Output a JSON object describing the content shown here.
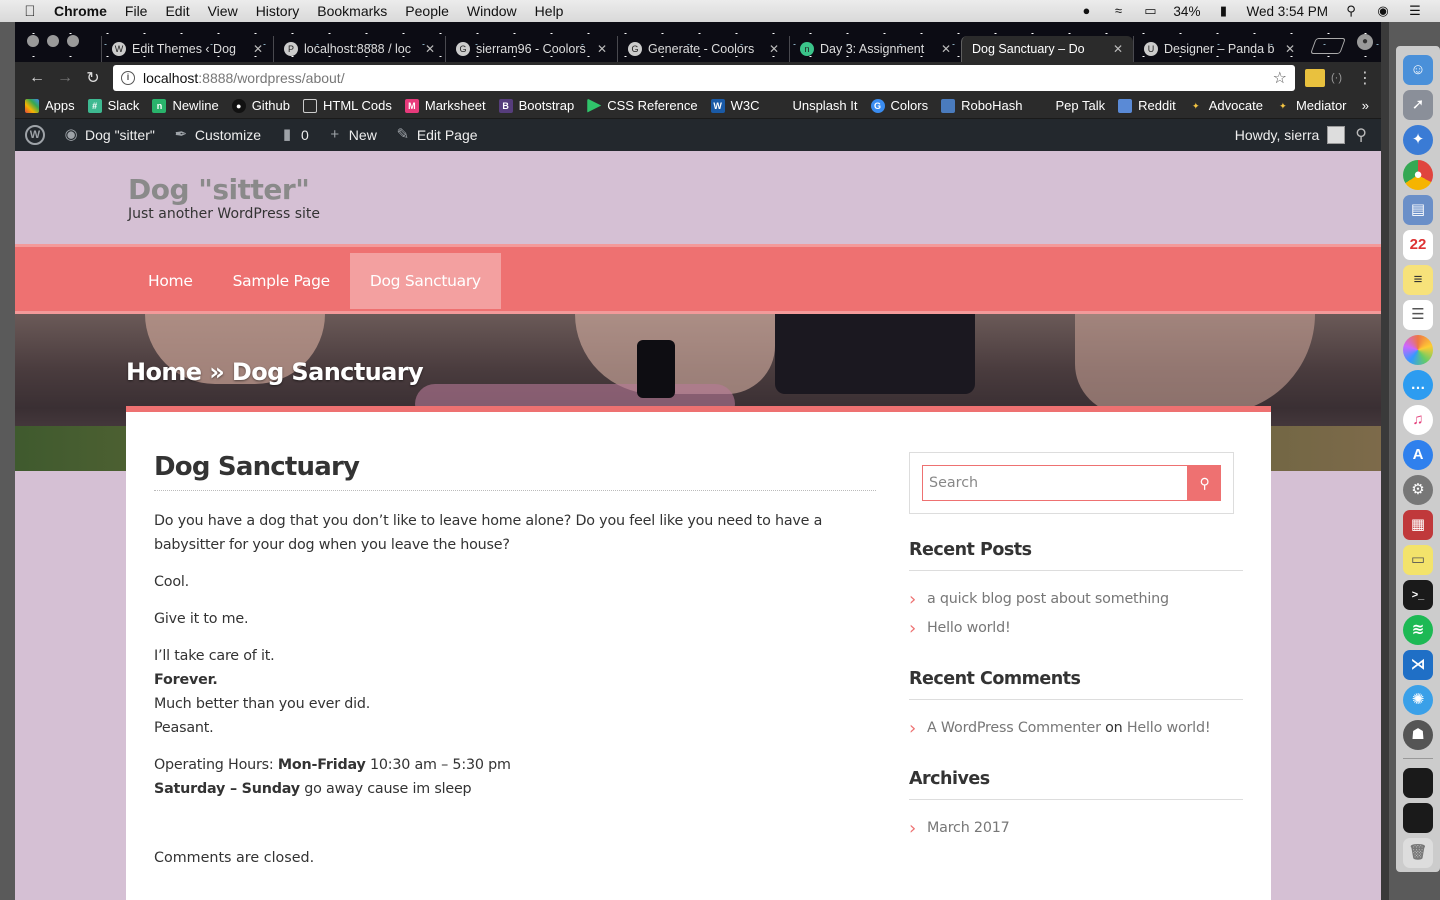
{
  "menubar": {
    "app_name": "Chrome",
    "menus": [
      "File",
      "Edit",
      "View",
      "History",
      "Bookmarks",
      "People",
      "Window",
      "Help"
    ],
    "battery": "34%",
    "clock": "Wed 3:54 PM"
  },
  "browser": {
    "tabs": [
      {
        "title": "Edit Themes ‹ Dog",
        "favicon": "wp-icon"
      },
      {
        "title": "localhost:8888 / loc",
        "favicon": "pma-icon"
      },
      {
        "title": "sierram96 - Coolors",
        "favicon": "chrome-icon"
      },
      {
        "title": "Generate - Coolors",
        "favicon": "chrome-icon"
      },
      {
        "title": "Day 3: Assignment",
        "favicon": "ga-icon"
      },
      {
        "title": "Dog Sanctuary – Do",
        "favicon": "wp-icon",
        "active": true
      },
      {
        "title": "Designer – Panda b",
        "favicon": "panda-icon"
      }
    ],
    "url_host": "localhost",
    "url_path": ":8888/wordpress/about/"
  },
  "bookmarks": [
    {
      "label": "Apps",
      "color": "#e0443e"
    },
    {
      "label": "Slack",
      "color": "#3eb991"
    },
    {
      "label": "Newline",
      "color": "#29b36b"
    },
    {
      "label": "Github",
      "color": "#111111"
    },
    {
      "label": "HTML Cods",
      "color": "#666666"
    },
    {
      "label": "Marksheet",
      "color": "#e73a7b"
    },
    {
      "label": "Bootstrap",
      "color": "#563d7c"
    },
    {
      "label": "CSS Reference",
      "color": "#30c46a"
    },
    {
      "label": "W3C",
      "color": "#1a5aa6"
    },
    {
      "label": "Unsplash It",
      "color": "#2b2b2b"
    },
    {
      "label": "Colors",
      "color": "#3a8cf0"
    },
    {
      "label": "RoboHash",
      "color": "#4a7bbd"
    },
    {
      "label": "Pep Talk",
      "color": "#2b2b2b"
    },
    {
      "label": "Reddit",
      "color": "#5a8ad6"
    },
    {
      "label": "Advocate",
      "color": "#222222"
    },
    {
      "label": "Mediator",
      "color": "#222222"
    }
  ],
  "wp_admin_bar": {
    "site_name": "Dog \"sitter\"",
    "customize": "Customize",
    "comments_count": "0",
    "new": "New",
    "edit_page": "Edit Page",
    "howdy": "Howdy, sierra"
  },
  "site": {
    "title": "Dog \"sitter\"",
    "tagline": "Just another WordPress site",
    "nav": [
      "Home",
      "Sample Page",
      "Dog Sanctuary"
    ],
    "breadcrumb": "Home » Dog Sanctuary",
    "accent": "#ee7171"
  },
  "post": {
    "title": "Dog Sanctuary",
    "p1": "Do you have a dog that you don’t like to leave home alone? Do you feel like you need to have a babysitter for your dog when you leave the house?",
    "p2": "Cool.",
    "p3": "Give it to me.",
    "p4_line1": "I’ll take care of it.",
    "p4_line2": "Forever.",
    "p4_line3": "Much better than you ever did.",
    "p4_line4": "Peasant.",
    "hours_label": "Operating Hours: ",
    "hours_days1": "Mon-Friday",
    "hours_time1": " 10:30 am – 5:30 pm",
    "hours_days2": "Saturday – Sunday",
    "hours_time2": " go away cause im sleep",
    "comments_closed": "Comments are closed."
  },
  "sidebar": {
    "search_placeholder": "Search",
    "recent_posts_title": "Recent Posts",
    "recent_posts": [
      "a quick blog post about something",
      "Hello world!"
    ],
    "recent_comments_title": "Recent Comments",
    "comment_author": "A WordPress Commenter",
    "comment_on": " on ",
    "comment_post": "Hello world!",
    "archives_title": "Archives",
    "archives": [
      "March 2017"
    ]
  }
}
